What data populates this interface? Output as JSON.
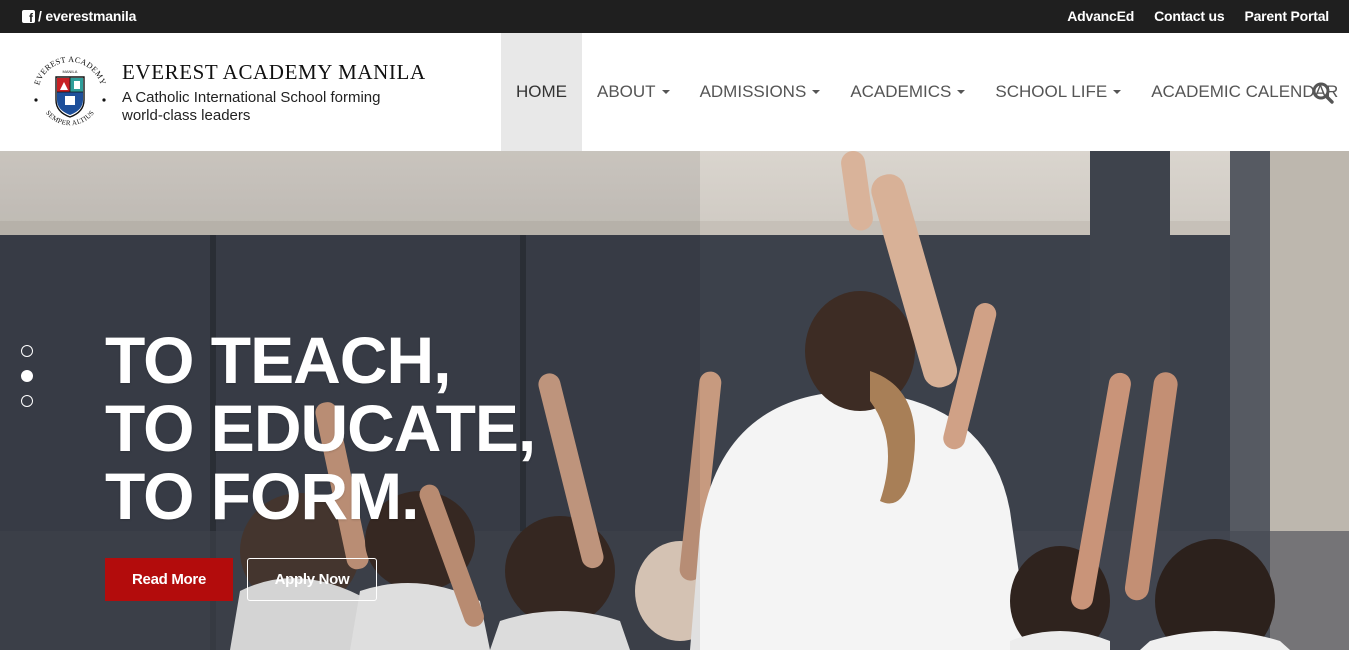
{
  "topbar": {
    "facebook_handle": "/ everestmanila",
    "links": [
      "AdvancEd",
      "Contact us",
      "Parent Portal"
    ]
  },
  "header": {
    "title": "EVEREST ACADEMY MANILA",
    "tagline": "A Catholic International School forming world-class leaders",
    "logo_text_top": "EVEREST ACADEMY",
    "logo_text_mid": "MANILA",
    "logo_text_bottom": "SEMPER ALTIUS"
  },
  "nav": {
    "items": [
      {
        "label": "HOME",
        "dropdown": false
      },
      {
        "label": "ABOUT",
        "dropdown": true
      },
      {
        "label": "ADMISSIONS",
        "dropdown": true
      },
      {
        "label": "ACADEMICS",
        "dropdown": true
      },
      {
        "label": "SCHOOL LIFE",
        "dropdown": true
      },
      {
        "label": "ACADEMIC CALENDAR",
        "dropdown": false
      }
    ],
    "search_icon": "search-icon"
  },
  "hero": {
    "headline": "TO TEACH, TO EDUCATE, TO FORM.",
    "read_more": "Read More",
    "apply_now": "Apply Now",
    "slide_count": 3,
    "active_slide": 2
  },
  "colors": {
    "topbar_bg": "#1f1f1f",
    "accent_red": "#b30c0c",
    "nav_text": "#555555",
    "nav_active_bg": "#e8e8e8"
  }
}
